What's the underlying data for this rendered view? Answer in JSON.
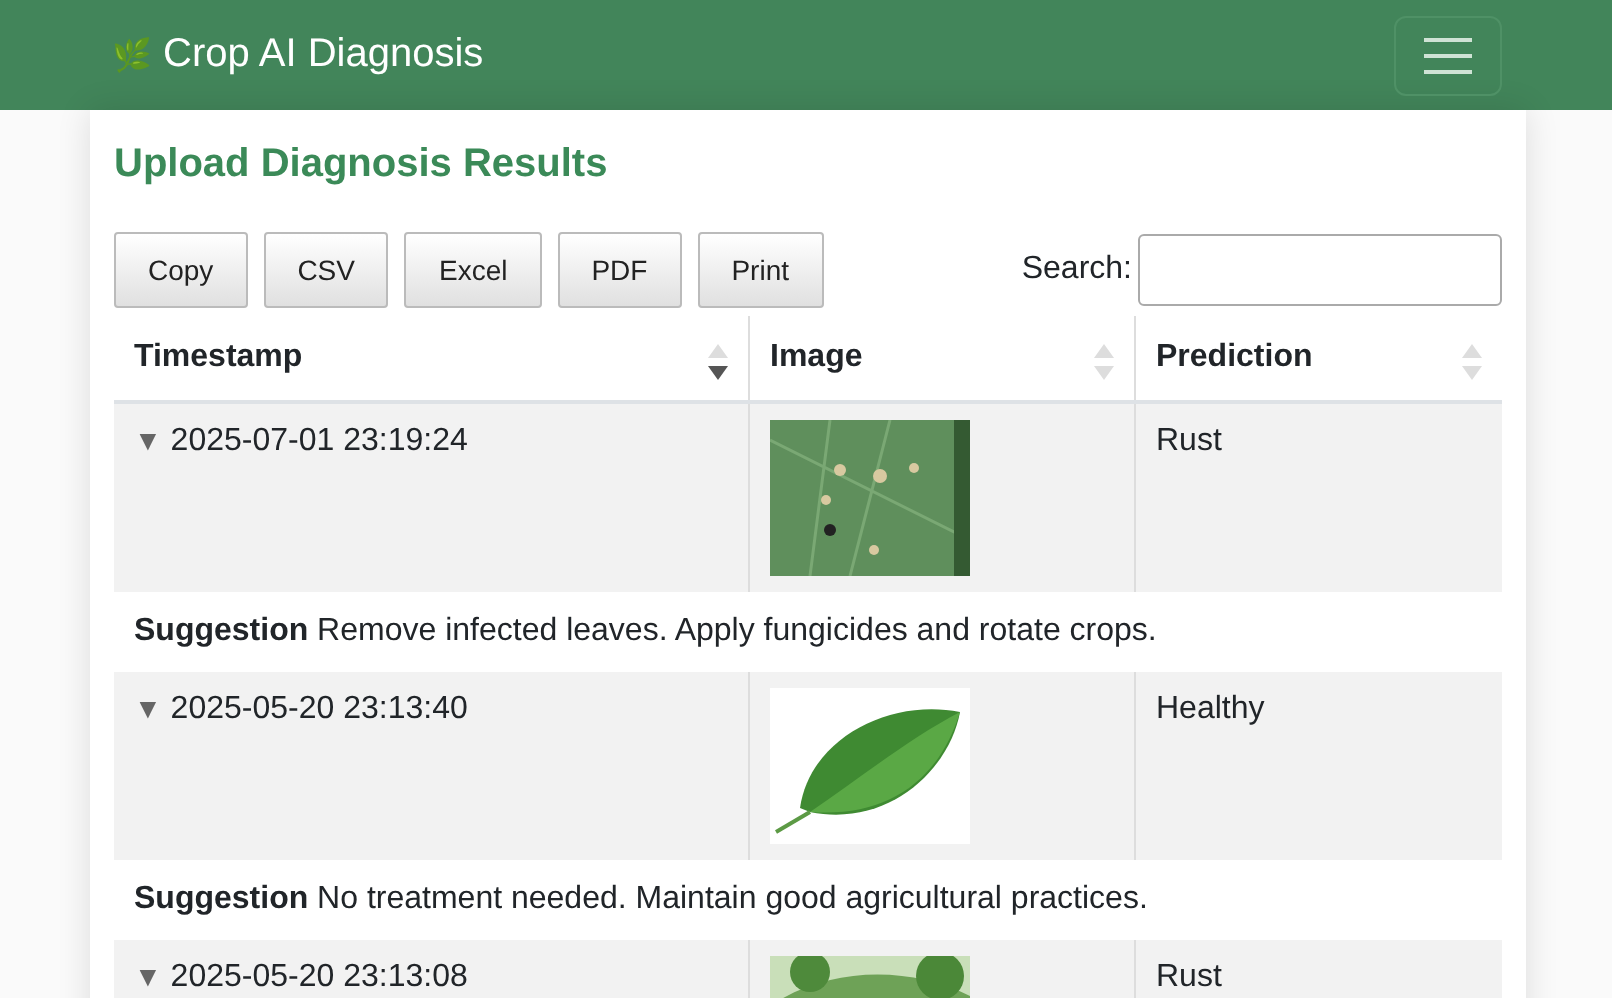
{
  "navbar": {
    "brand_icon": "🌿",
    "brand": "Crop AI Diagnosis"
  },
  "card": {
    "title": "Upload Diagnosis Results"
  },
  "export_buttons": [
    "Copy",
    "CSV",
    "Excel",
    "PDF",
    "Print"
  ],
  "search": {
    "label": "Search:"
  },
  "table": {
    "columns": [
      {
        "label": "Timestamp",
        "sorted": true
      },
      {
        "label": "Image",
        "sorted": false
      },
      {
        "label": "Prediction",
        "sorted": false
      }
    ],
    "rows": [
      {
        "toggle": "▼",
        "timestamp": "2025-07-01 23:19:24",
        "prediction": "Rust",
        "suggestion": "**Suggestion** Remove infected leaves. Apply fungicides and rotate crops."
      },
      {
        "toggle": "▼",
        "timestamp": "2025-05-20 23:13:40",
        "prediction": "Healthy",
        "suggestion": "**Suggestion** No treatment needed. Maintain good agricultural practices."
      },
      {
        "toggle": "▼",
        "timestamp": "2025-05-20 23:13:08",
        "prediction": "Rust"
      }
    ]
  }
}
